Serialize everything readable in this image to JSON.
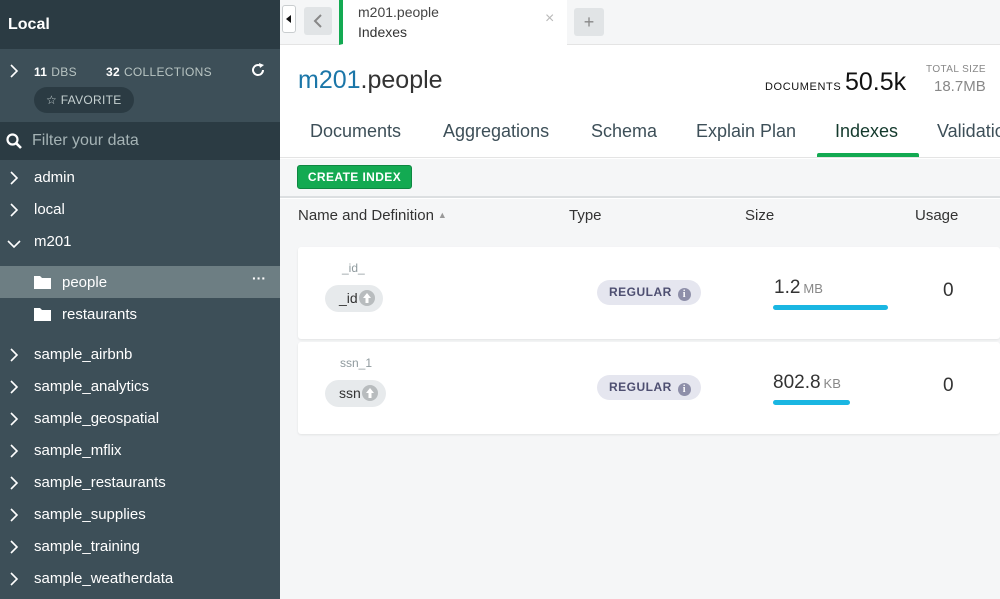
{
  "sidebar": {
    "title": "Local",
    "dbs_count": "11",
    "dbs_label": "DBS",
    "collections_count": "32",
    "collections_label": "COLLECTIONS",
    "favorite_label": "FAVORITE",
    "filter_placeholder": "Filter your data",
    "databases_top": [
      {
        "name": "admin",
        "expanded": false
      },
      {
        "name": "local",
        "expanded": false
      },
      {
        "name": "m201",
        "expanded": true
      }
    ],
    "collections": [
      {
        "name": "people",
        "active": true
      },
      {
        "name": "restaurants",
        "active": false
      }
    ],
    "databases_bottom": [
      {
        "name": "sample_airbnb"
      },
      {
        "name": "sample_analytics"
      },
      {
        "name": "sample_geospatial"
      },
      {
        "name": "sample_mflix"
      },
      {
        "name": "sample_restaurants"
      },
      {
        "name": "sample_supplies"
      },
      {
        "name": "sample_training"
      },
      {
        "name": "sample_weatherdata"
      }
    ]
  },
  "tab": {
    "namespace": "m201.people",
    "subtitle": "Indexes",
    "close_glyph": "×",
    "new_tab_glyph": "+"
  },
  "header": {
    "db": "m201",
    "collection": ".people",
    "documents_label": "DOCUMENTS",
    "documents_value": "50.5k",
    "total_size_label": "TOTAL SIZE",
    "total_size_value": "18.7MB"
  },
  "subtabs": [
    "Documents",
    "Aggregations",
    "Schema",
    "Explain Plan",
    "Indexes",
    "Validatio"
  ],
  "active_subtab": "Indexes",
  "toolbar": {
    "create_index_label": "CREATE INDEX"
  },
  "table": {
    "headers": {
      "name": "Name and Definition",
      "type": "Type",
      "size": "Size",
      "usage": "Usage"
    },
    "rows": [
      {
        "name": "_id_",
        "field": "_id",
        "type": "REGULAR",
        "size_value": "1.2",
        "size_unit": "MB",
        "size_fraction": 1.0,
        "usage": "0"
      },
      {
        "name": "ssn_1",
        "field": "ssn",
        "type": "REGULAR",
        "size_value": "802.8",
        "size_unit": "KB",
        "size_fraction": 0.67,
        "usage": "0"
      }
    ]
  },
  "colors": {
    "accent_green": "#13aa52",
    "sidebar_bg": "#3d4f58",
    "size_bar": "#1ab6e2",
    "db_name": "#1b76a8"
  }
}
